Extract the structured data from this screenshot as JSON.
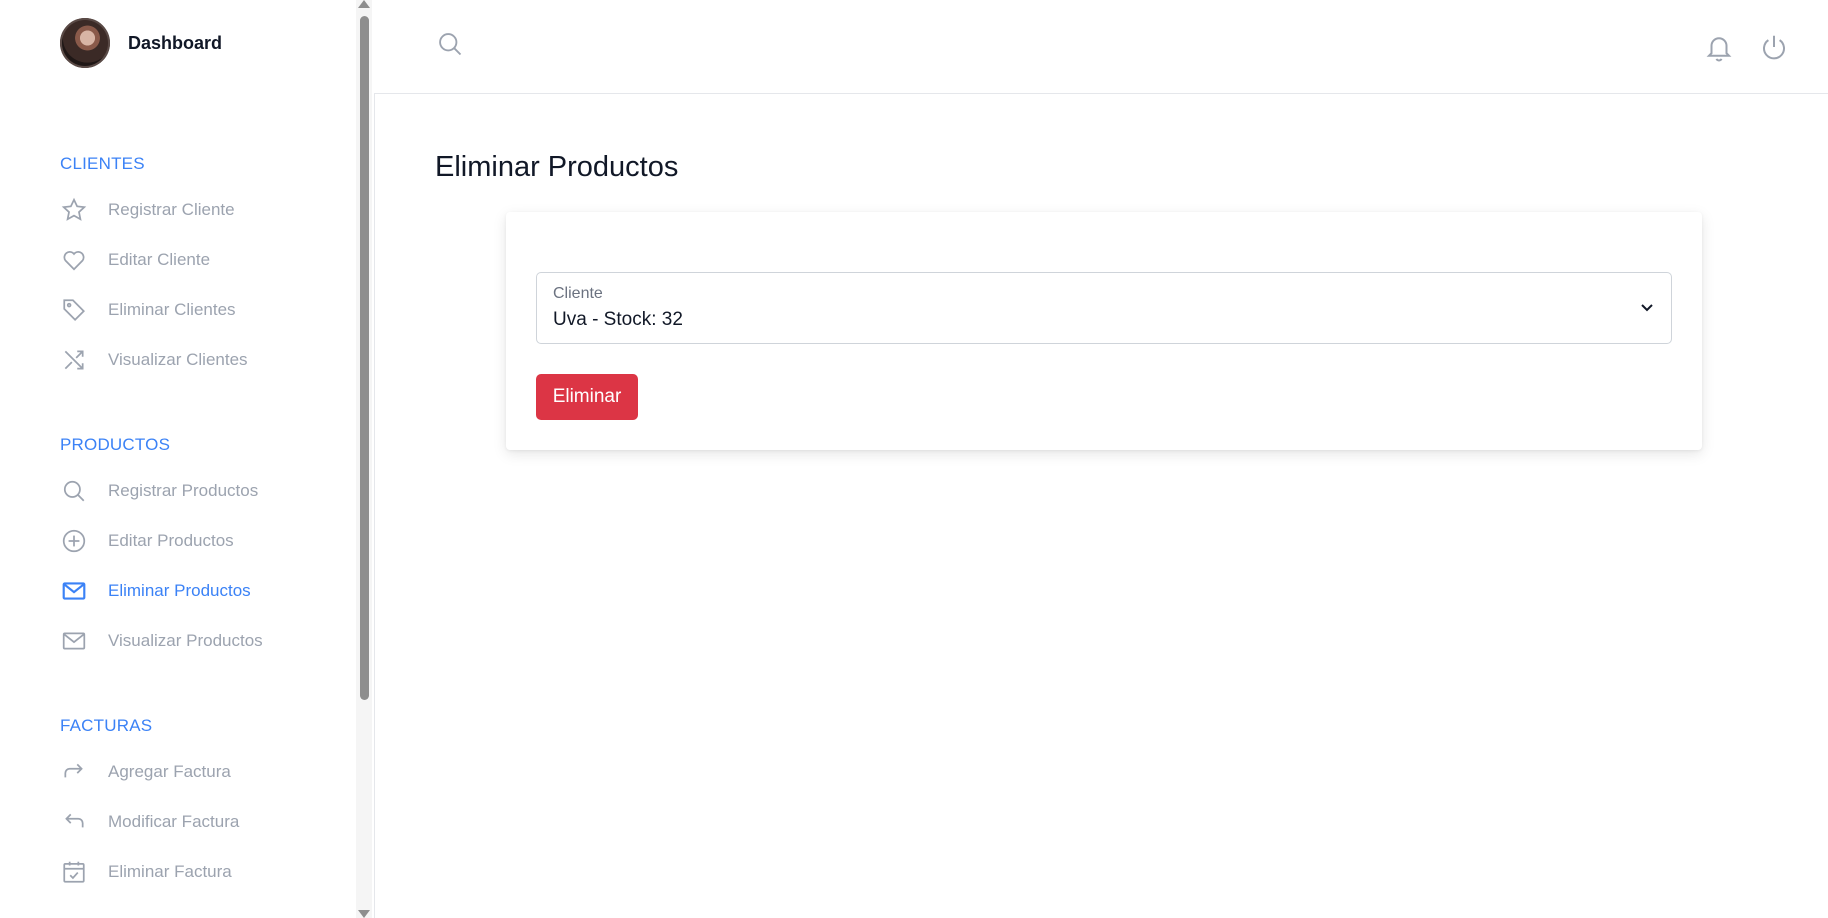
{
  "sidebar": {
    "profile_name": "Dashboard",
    "sections": [
      {
        "title": "CLIENTES",
        "items": [
          {
            "label": "Registrar Cliente",
            "icon": "star-icon"
          },
          {
            "label": "Editar Cliente",
            "icon": "heart-icon"
          },
          {
            "label": "Eliminar Clientes",
            "icon": "tag-icon"
          },
          {
            "label": "Visualizar Clientes",
            "icon": "shuffle-icon"
          }
        ]
      },
      {
        "title": "PRODUCTOS",
        "items": [
          {
            "label": "Registrar Productos",
            "icon": "search-icon"
          },
          {
            "label": "Editar Productos",
            "icon": "plus-circle-icon"
          },
          {
            "label": "Eliminar Productos",
            "icon": "mail-icon",
            "active": true
          },
          {
            "label": "Visualizar Productos",
            "icon": "mail-icon"
          }
        ]
      },
      {
        "title": "FACTURAS",
        "items": [
          {
            "label": "Agregar Factura",
            "icon": "redo-icon"
          },
          {
            "label": "Modificar Factura",
            "icon": "undo-icon"
          },
          {
            "label": "Eliminar Factura",
            "icon": "calendar-check-icon"
          }
        ]
      }
    ]
  },
  "main": {
    "title": "Eliminar Productos",
    "form": {
      "select_label": "Cliente",
      "select_value": "Uva - Stock: 32",
      "delete_label": "Eliminar"
    }
  },
  "colors": {
    "accent": "#3b82f6",
    "danger": "#dc3545",
    "muted": "#9ca3af"
  }
}
